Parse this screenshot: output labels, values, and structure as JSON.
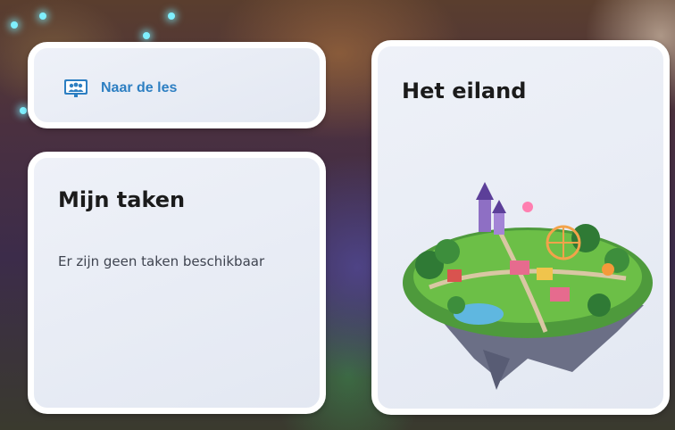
{
  "lesson_card": {
    "link_label": "Naar de les",
    "icon": "presentation-group-icon"
  },
  "tasks_card": {
    "title": "Mijn taken",
    "empty_message": "Er zijn geen taken beschikbaar"
  },
  "island_card": {
    "title": "Het eiland",
    "image": "floating-island-illustration"
  },
  "colors": {
    "link": "#2d7fc2",
    "card_bg": "#e9edf5",
    "card_border": "#ffffff",
    "title": "#1b1b1b"
  }
}
